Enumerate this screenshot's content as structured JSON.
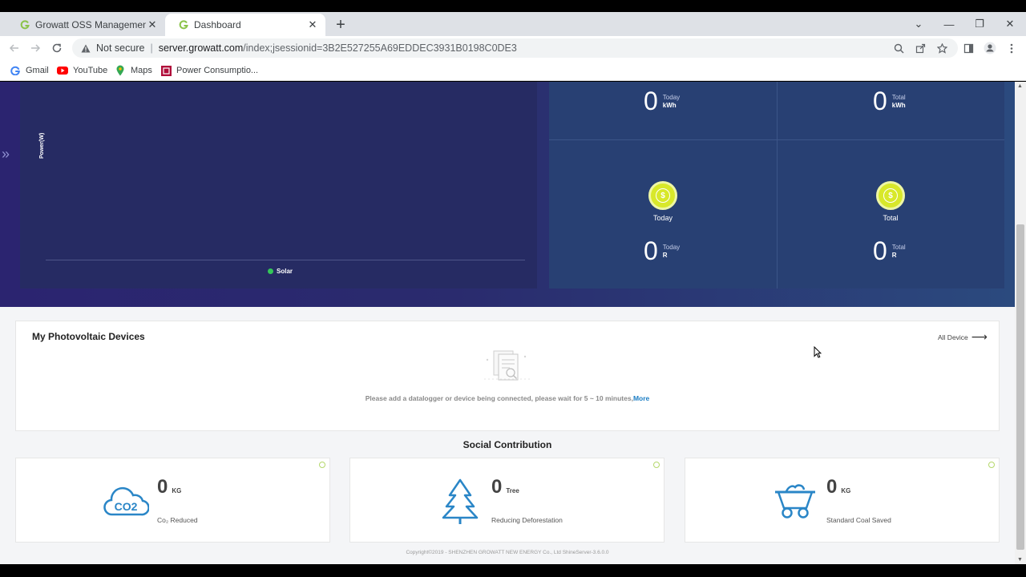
{
  "browser": {
    "tabs": [
      {
        "title": "Growatt OSS Management syste",
        "active": false
      },
      {
        "title": "Dashboard",
        "active": true
      }
    ],
    "new_tab": "+",
    "controls": {
      "tab_search": "⌄",
      "minimize": "—",
      "restore": "❐",
      "close": "✕"
    },
    "address": {
      "security": "Not secure",
      "host": "server.growatt.com",
      "path": "/index;jsessionid=3B2E527255A69EDDEC3931B0198C0DE3"
    },
    "bookmarks": [
      "Gmail",
      "YouTube",
      "Maps",
      "Power Consumptio..."
    ]
  },
  "chart": {
    "ylabel": "Power(W)",
    "legend": "Solar",
    "legend_color": "#34c759"
  },
  "stats": {
    "energy_today": {
      "value": "0",
      "label": "Today",
      "unit": "kWh"
    },
    "energy_total": {
      "value": "0",
      "label": "Total",
      "unit": "kWh"
    },
    "revenue_today_label": "Today",
    "revenue_total_label": "Total",
    "income_today": {
      "value": "0",
      "label": "Today",
      "unit": "R"
    },
    "income_total": {
      "value": "0",
      "label": "Total",
      "unit": "R"
    },
    "coin_symbol": "$"
  },
  "devices": {
    "title": "My Photovoltaic Devices",
    "all_link": "All Device",
    "message": "Please add a datalogger or device being connected, please wait for 5 ~ 10 minutes,",
    "more": "More"
  },
  "social": {
    "title": "Social Contribution",
    "cards": [
      {
        "icon": "co2-cloud-icon",
        "icon_text": "CO2",
        "value": "0",
        "unit": "KG",
        "caption": "Co₂ Reduced"
      },
      {
        "icon": "tree-icon",
        "value": "0",
        "unit": "Tree",
        "caption": "Reducing Deforestation"
      },
      {
        "icon": "coal-cart-icon",
        "value": "0",
        "unit": "KG",
        "caption": "Standard Coal Saved"
      }
    ]
  },
  "footer": "Copyright©2019 - SHENZHEN GROWATT NEW ENERGY Co., Ltd ShineServer-3.6.0.0",
  "colors": {
    "accent_icon": "#2a86c7",
    "coin": "#d8e82a",
    "hero": "#2a2b6e"
  }
}
